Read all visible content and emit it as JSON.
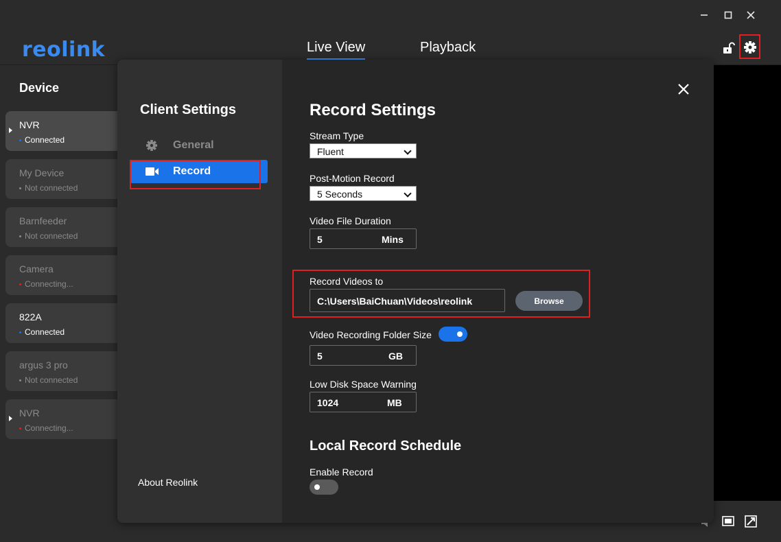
{
  "header": {
    "logo": "reolink",
    "tabs": [
      {
        "label": "Live View",
        "active": true
      },
      {
        "label": "Playback",
        "active": false
      }
    ]
  },
  "window_controls": [
    "minimize-icon",
    "maximize-icon",
    "close-icon"
  ],
  "sidebar": {
    "title": "Device",
    "devices": [
      {
        "name": "NVR",
        "status": "Connected",
        "status_color": "#1a73e8",
        "selected": true,
        "expandable": true
      },
      {
        "name": "My Device",
        "status": "Not connected",
        "status_color": "#8a8a8a",
        "selected": false,
        "expandable": false
      },
      {
        "name": "Barnfeeder",
        "status": "Not connected",
        "status_color": "#8a8a8a",
        "selected": false,
        "expandable": false
      },
      {
        "name": "Camera",
        "status": "Connecting...",
        "status_color": "#e02020",
        "selected": false,
        "expandable": false
      },
      {
        "name": "822A",
        "status": "Connected",
        "status_color": "#1a73e8",
        "selected": false,
        "expandable": false
      },
      {
        "name": "argus 3 pro",
        "status": "Not connected",
        "status_color": "#8a8a8a",
        "selected": false,
        "expandable": false
      },
      {
        "name": "NVR",
        "status": "Connecting...",
        "status_color": "#e02020",
        "selected": false,
        "expandable": true
      }
    ]
  },
  "modal": {
    "title": "Client Settings",
    "menu": [
      {
        "label": "General",
        "icon": "gear-icon",
        "active": false
      },
      {
        "label": "Record",
        "icon": "video-camera-icon",
        "active": true
      }
    ],
    "about": "About Reolink",
    "record_settings": {
      "title": "Record Settings",
      "stream_type": {
        "label": "Stream Type",
        "value": "Fluent"
      },
      "post_motion": {
        "label": "Post-Motion Record",
        "value": "5 Seconds"
      },
      "file_duration": {
        "label": "Video File Duration",
        "value": "5",
        "unit": "Mins"
      },
      "record_to": {
        "label": "Record Videos to",
        "value": "C:\\Users\\BaiChuan\\Videos\\reolink",
        "browse": "Browse"
      },
      "folder_size": {
        "label": "Video Recording Folder Size",
        "enabled": true,
        "value": "5",
        "unit": "GB"
      },
      "low_disk": {
        "label": "Low Disk Space Warning",
        "value": "1024",
        "unit": "MB"
      }
    },
    "schedule": {
      "title": "Local Record Schedule",
      "enable_label": "Enable Record",
      "enabled": false
    }
  },
  "colors": {
    "accent": "#1a73e8",
    "highlight": "#e02020",
    "modal_bg": "#262626",
    "panel_bg": "#303030"
  }
}
